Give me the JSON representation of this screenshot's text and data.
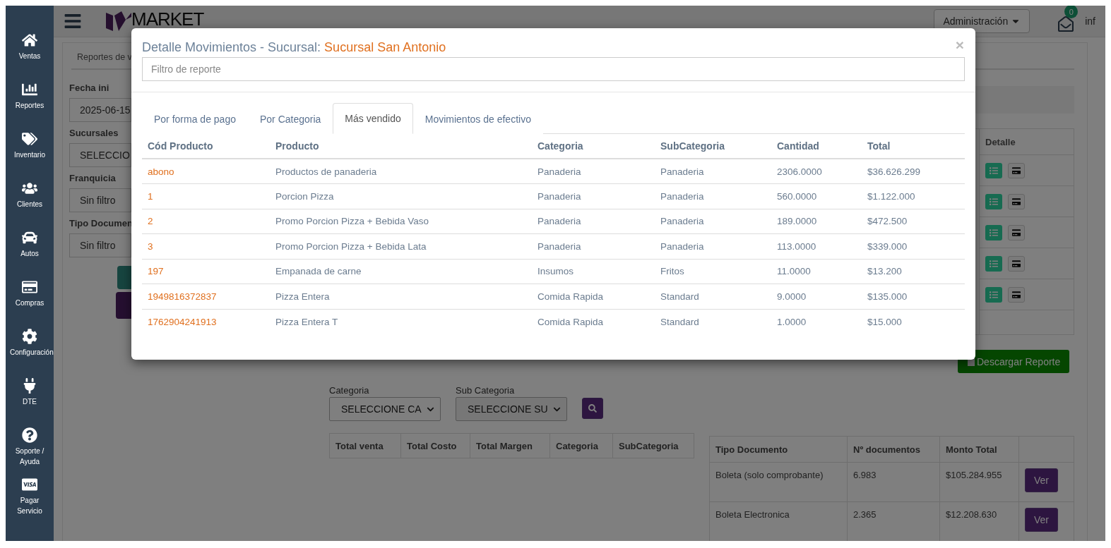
{
  "sidebar": {
    "items": [
      {
        "label": "Ventas"
      },
      {
        "label": "Reportes"
      },
      {
        "label": "Inventario"
      },
      {
        "label": "Clientes"
      },
      {
        "label": "Autos"
      },
      {
        "label": "Compras"
      },
      {
        "label": "Configuración"
      },
      {
        "label": "DTE"
      },
      {
        "label": "Soporte / Ayuda"
      },
      {
        "label": "Pagar Servicio"
      }
    ]
  },
  "navbar": {
    "brand": "MARKET",
    "menu": "Administración",
    "mail_badge": "0",
    "user": "inf"
  },
  "report_page": {
    "tab": "Reportes de v",
    "filters": [
      {
        "label": "Fecha ini",
        "value": "2025-06-15"
      },
      {
        "label": "Sucursales",
        "value": "SELECCIO"
      },
      {
        "label": "Franquicia",
        "value": "Sin filtro"
      },
      {
        "label": "Tipo Documen",
        "value": "Sin filtro"
      }
    ],
    "detail_table": {
      "header": "Detalle",
      "rows": [
        {
          "kind": "actions"
        },
        {
          "kind": "actions"
        },
        {
          "kind": "actions"
        },
        {
          "kind": "actions"
        },
        {
          "kind": "actions"
        },
        {
          "kind": "empty"
        }
      ]
    },
    "download_button": "Descargar Reporte",
    "category_filters": [
      {
        "label": "Categoria",
        "value": "SELECCIONE CA"
      },
      {
        "label": "Sub Categoria",
        "value": "SELECCIONE SU"
      }
    ],
    "summary_table": {
      "columns": [
        "Total venta",
        "Total Costo",
        "Total Margen",
        "Categoria",
        "SubCategoria"
      ]
    },
    "document_table": {
      "columns": [
        "Tipo Documento",
        "Nº documentos",
        "Monto Total"
      ],
      "rows": [
        {
          "tipo": "Boleta (solo comprobante)",
          "documentos": "6.983",
          "monto": "$105.284.955",
          "action": "Ver"
        },
        {
          "tipo": "Boleta Electronica",
          "documentos": "2.365",
          "monto": "$12.208.630",
          "action": "Ver"
        }
      ]
    }
  },
  "modal": {
    "title": "Detalle Movimientos - Sucursal:",
    "branch": "Sucursal San Antonio",
    "close": "×",
    "filter_placeholder": "Filtro de reporte",
    "tabs": [
      {
        "label": "Por forma de pago",
        "selected": false
      },
      {
        "label": "Por Categoria",
        "selected": false
      },
      {
        "label": "Más vendido",
        "selected": true
      },
      {
        "label": "Movimientos de efectivo",
        "selected": false
      }
    ],
    "columns": [
      "Cód Producto",
      "Producto",
      "Categoria",
      "SubCategoria",
      "Cantidad",
      "Total"
    ],
    "rows": [
      {
        "code": "abono",
        "product": "Productos de panaderia",
        "category": "Panaderia",
        "subcategory": "Panaderia",
        "quantity": "2306.0000",
        "total": "$36.626.299"
      },
      {
        "code": "1",
        "product": "Porcion Pizza",
        "category": "Panaderia",
        "subcategory": "Panaderia",
        "quantity": "560.0000",
        "total": "$1.122.000"
      },
      {
        "code": "2",
        "product": "Promo Porcion Pizza + Bebida Vaso",
        "category": "Panaderia",
        "subcategory": "Panaderia",
        "quantity": "189.0000",
        "total": "$472.500"
      },
      {
        "code": "3",
        "product": "Promo Porcion Pizza + Bebida Lata",
        "category": "Panaderia",
        "subcategory": "Panaderia",
        "quantity": "113.0000",
        "total": "$339.000"
      },
      {
        "code": "197",
        "product": "Empanada de carne",
        "category": "Insumos",
        "subcategory": "Fritos",
        "quantity": "11.0000",
        "total": "$13.200"
      },
      {
        "code": "1949816372837",
        "product": "Pizza Entera",
        "category": "Comida Rapida",
        "subcategory": "Standard",
        "quantity": "9.0000",
        "total": "$135.000"
      },
      {
        "code": "1762904241913",
        "product": "Pizza Entera T",
        "category": "Comida Rapida",
        "subcategory": "Standard",
        "quantity": "1.0000",
        "total": "$15.000"
      }
    ]
  }
}
